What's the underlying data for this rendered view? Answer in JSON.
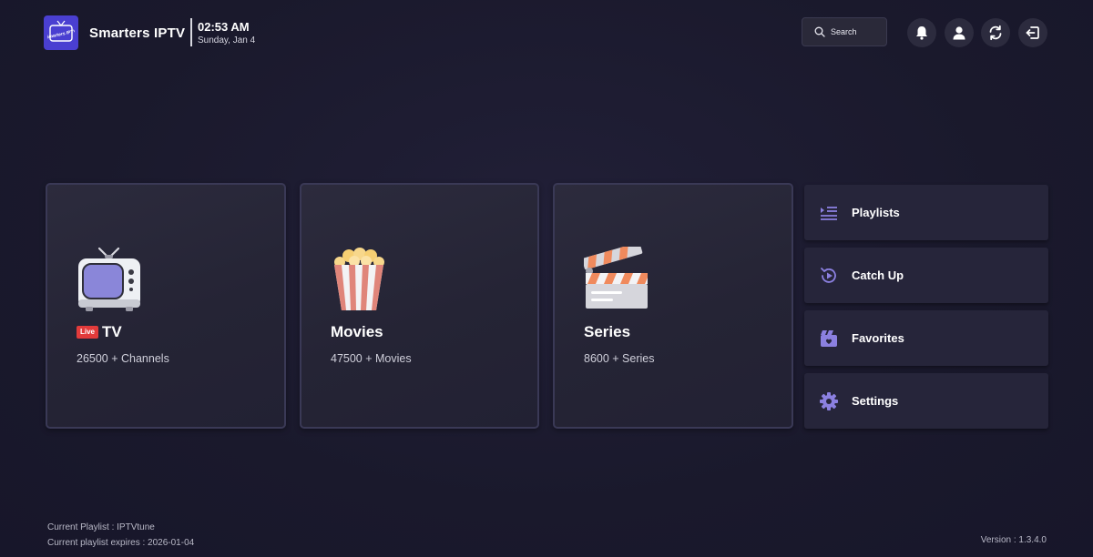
{
  "header": {
    "app_title": "Smarters IPTV",
    "logo_text": "Smarters IPTV",
    "time": "02:53 AM",
    "date": "Sunday, Jan 4",
    "search_placeholder": "Search",
    "icons": [
      "bell-icon",
      "user-icon",
      "refresh-icon",
      "logout-icon"
    ]
  },
  "cards": [
    {
      "id": "live-tv",
      "badge": "Live",
      "title": "TV",
      "count": "26500 +  Channels",
      "icon": "tv-icon"
    },
    {
      "id": "movies",
      "title": "Movies",
      "count": "47500 +  Movies",
      "icon": "popcorn-icon"
    },
    {
      "id": "series",
      "title": "Series",
      "count": "8600 +  Series",
      "icon": "clapperboard-icon"
    }
  ],
  "side_menu": [
    {
      "label": "Playlists",
      "icon": "playlist-icon"
    },
    {
      "label": "Catch Up",
      "icon": "catch-up-icon"
    },
    {
      "label": "Favorites",
      "icon": "favorites-icon"
    },
    {
      "label": "Settings",
      "icon": "gear-icon"
    }
  ],
  "footer": {
    "current_playlist": "Current Playlist : IPTVtune",
    "expires": "Current playlist expires : 2026-01-04",
    "version": "Version : 1.3.4.0"
  },
  "colors": {
    "background": "#1b1a2e",
    "accent": "#7b6fd6",
    "live_red": "#e23b3b",
    "logo_bg": "#4a3fd1"
  }
}
